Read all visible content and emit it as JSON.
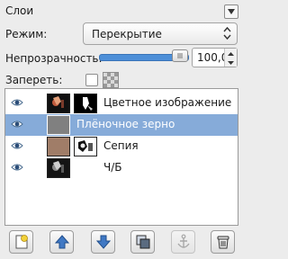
{
  "panel": {
    "title": "Слои"
  },
  "mode": {
    "label": "Режим:",
    "value": "Перекрытие"
  },
  "opacity": {
    "label": "Непрозрачность:",
    "value": "100,0",
    "level_percent": 100
  },
  "lock": {
    "label": "Запереть:",
    "checked": false
  },
  "layers": [
    {
      "name": "Цветное изображение",
      "visible": true,
      "selected": false,
      "has_mask": true
    },
    {
      "name": "Плёночное зерно",
      "visible": true,
      "selected": true,
      "has_mask": false
    },
    {
      "name": "Сепия",
      "visible": true,
      "selected": false,
      "has_mask": true
    },
    {
      "name": "Ч/Б",
      "visible": true,
      "selected": false,
      "has_mask": false
    }
  ],
  "toolbar": [
    {
      "icon": "new-layer-icon",
      "enabled": true
    },
    {
      "icon": "raise-layer-icon",
      "enabled": true
    },
    {
      "icon": "lower-layer-icon",
      "enabled": true
    },
    {
      "icon": "duplicate-layer-icon",
      "enabled": true
    },
    {
      "icon": "anchor-layer-icon",
      "enabled": false
    },
    {
      "icon": "delete-layer-icon",
      "enabled": true
    }
  ],
  "colors": {
    "selection": "#86abd9",
    "slider_fill": "#4d8fd8",
    "sepia_swatch": "#a07d68",
    "grain_swatch": "#808080"
  }
}
